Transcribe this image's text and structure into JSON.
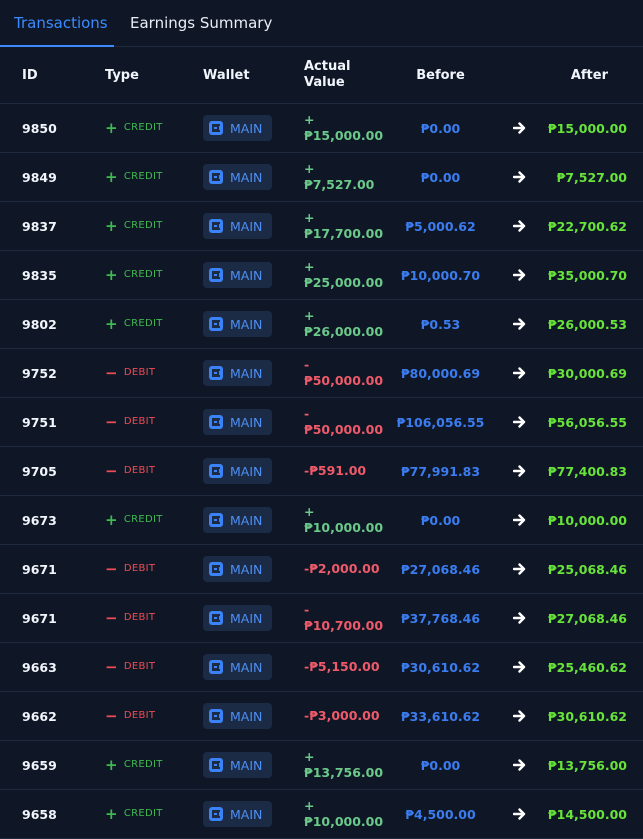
{
  "tabs": [
    {
      "label": "Transactions",
      "active": true
    },
    {
      "label": "Earnings Summary",
      "active": false
    }
  ],
  "columns": {
    "id": "ID",
    "type": "Type",
    "wallet": "Wallet",
    "actual_value": "Actual\nValue",
    "before": "Before",
    "after": "After"
  },
  "colors": {
    "credit": "#3fb950",
    "debit": "#f04b55",
    "before": "#3b7df0",
    "after": "#67e33a",
    "accent": "#3b8bff"
  },
  "rows": [
    {
      "id": "9850",
      "kind": "credit",
      "type": "CREDIT",
      "wallet": "MAIN",
      "actual": "+\n₱15,000.00",
      "before": "₱0.00",
      "after": "₱15,000.00"
    },
    {
      "id": "9849",
      "kind": "credit",
      "type": "CREDIT",
      "wallet": "MAIN",
      "actual": "+₱7,527.00",
      "before": "₱0.00",
      "after": "₱7,527.00"
    },
    {
      "id": "9837",
      "kind": "credit",
      "type": "CREDIT",
      "wallet": "MAIN",
      "actual": "+\n₱17,700.00",
      "before": "₱5,000.62",
      "after": "₱22,700.62"
    },
    {
      "id": "9835",
      "kind": "credit",
      "type": "CREDIT",
      "wallet": "MAIN",
      "actual": "+\n₱25,000.00",
      "before": "₱10,000.70",
      "after": "₱35,000.70"
    },
    {
      "id": "9802",
      "kind": "credit",
      "type": "CREDIT",
      "wallet": "MAIN",
      "actual": "+\n₱26,000.00",
      "before": "₱0.53",
      "after": "₱26,000.53"
    },
    {
      "id": "9752",
      "kind": "debit",
      "type": "DEBIT",
      "wallet": "MAIN",
      "actual": "-\n₱50,000.00",
      "before": "₱80,000.69",
      "after": "₱30,000.69"
    },
    {
      "id": "9751",
      "kind": "debit",
      "type": "DEBIT",
      "wallet": "MAIN",
      "actual": "-\n₱50,000.00",
      "before": "₱106,056.55",
      "after": "₱56,056.55"
    },
    {
      "id": "9705",
      "kind": "debit",
      "type": "DEBIT",
      "wallet": "MAIN",
      "actual": "-₱591.00",
      "before": "₱77,991.83",
      "after": "₱77,400.83"
    },
    {
      "id": "9673",
      "kind": "credit",
      "type": "CREDIT",
      "wallet": "MAIN",
      "actual": "+\n₱10,000.00",
      "before": "₱0.00",
      "after": "₱10,000.00"
    },
    {
      "id": "9671",
      "kind": "debit",
      "type": "DEBIT",
      "wallet": "MAIN",
      "actual": "-₱2,000.00",
      "before": "₱27,068.46",
      "after": "₱25,068.46"
    },
    {
      "id": "9671",
      "kind": "debit",
      "type": "DEBIT",
      "wallet": "MAIN",
      "actual": "-\n₱10,700.00",
      "before": "₱37,768.46",
      "after": "₱27,068.46"
    },
    {
      "id": "9663",
      "kind": "debit",
      "type": "DEBIT",
      "wallet": "MAIN",
      "actual": "-₱5,150.00",
      "before": "₱30,610.62",
      "after": "₱25,460.62"
    },
    {
      "id": "9662",
      "kind": "debit",
      "type": "DEBIT",
      "wallet": "MAIN",
      "actual": "-₱3,000.00",
      "before": "₱33,610.62",
      "after": "₱30,610.62"
    },
    {
      "id": "9659",
      "kind": "credit",
      "type": "CREDIT",
      "wallet": "MAIN",
      "actual": "+\n₱13,756.00",
      "before": "₱0.00",
      "after": "₱13,756.00"
    },
    {
      "id": "9658",
      "kind": "credit",
      "type": "CREDIT",
      "wallet": "MAIN",
      "actual": "+\n₱10,000.00",
      "before": "₱4,500.00",
      "after": "₱14,500.00"
    }
  ]
}
